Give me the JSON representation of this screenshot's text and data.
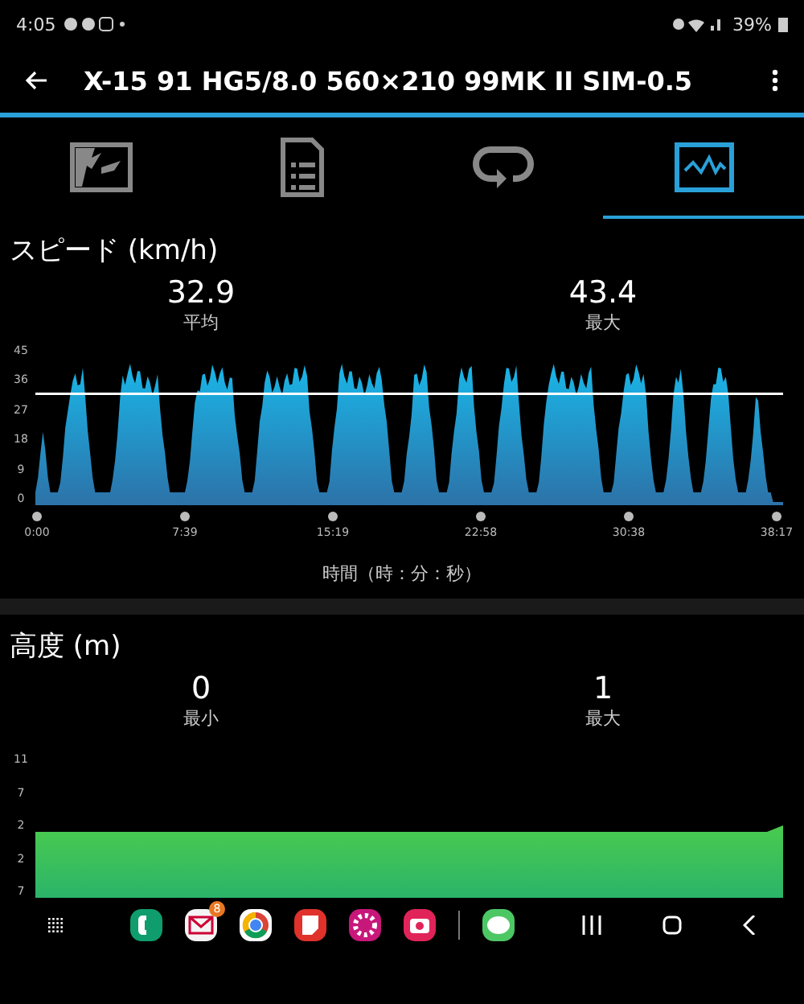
{
  "status_bar": {
    "time": "4:05",
    "battery": "39%"
  },
  "app_bar": {
    "title": "X-15 91 HG5/8.0 560×210 99MK II SIM-0.5"
  },
  "tabs": [
    {
      "kind": "map",
      "selected": false
    },
    {
      "kind": "document",
      "selected": false
    },
    {
      "kind": "loop",
      "selected": false
    },
    {
      "kind": "graph",
      "selected": true
    }
  ],
  "speed": {
    "title": "スピード (km/h)",
    "stats": [
      {
        "value": "32.9",
        "label": "平均"
      },
      {
        "value": "43.4",
        "label": "最大"
      }
    ],
    "y_ticks": [
      "45",
      "36",
      "27",
      "18",
      "9",
      "0"
    ],
    "x_ticks": [
      "0:00",
      "7:39",
      "15:19",
      "22:58",
      "30:38",
      "38:17"
    ],
    "x_title": "時間（時：分：秒）"
  },
  "altitude": {
    "title": "高度 (m)",
    "stats": [
      {
        "value": "0",
        "label": "最小"
      },
      {
        "value": "1",
        "label": "最大"
      }
    ],
    "y_ticks": [
      "11",
      "7",
      "2",
      "2",
      "7"
    ]
  },
  "nav_bar": {
    "apps": [
      {
        "kind": "phone",
        "color": "#0f9d6e"
      },
      {
        "kind": "mail",
        "color": "#f4f4f4",
        "badge": "8"
      },
      {
        "kind": "browser",
        "color": "#ffffff"
      },
      {
        "kind": "notes",
        "color": "#e0312b"
      },
      {
        "kind": "flower",
        "color": "#c8177a"
      },
      {
        "kind": "camera",
        "color": "#e0245a"
      },
      {
        "kind": "chat",
        "color": "#4cc764"
      }
    ]
  }
}
